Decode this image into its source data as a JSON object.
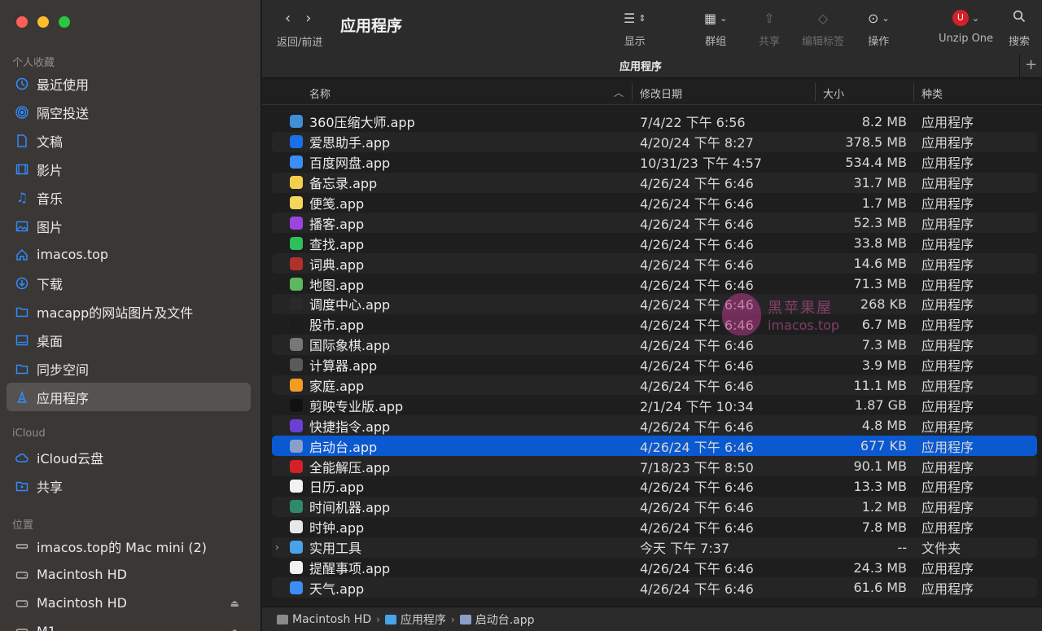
{
  "sidebar": {
    "sections": [
      {
        "title": "个人收藏",
        "items": [
          {
            "label": "最近使用",
            "icon": "clock-icon"
          },
          {
            "label": "隔空投送",
            "icon": "airdrop-icon"
          },
          {
            "label": "文稿",
            "icon": "document-icon"
          },
          {
            "label": "影片",
            "icon": "film-icon"
          },
          {
            "label": "音乐",
            "icon": "music-icon"
          },
          {
            "label": "图片",
            "icon": "photo-icon"
          },
          {
            "label": "imacos.top",
            "icon": "home-icon"
          },
          {
            "label": "下载",
            "icon": "download-icon"
          },
          {
            "label": "macapp的网站图片及文件",
            "icon": "folder-icon"
          },
          {
            "label": "桌面",
            "icon": "desktop-icon"
          },
          {
            "label": "同步空间",
            "icon": "folder-icon"
          },
          {
            "label": "应用程序",
            "icon": "applications-icon",
            "active": true
          }
        ]
      },
      {
        "title": "iCloud",
        "items": [
          {
            "label": "iCloud云盘",
            "icon": "cloud-icon"
          },
          {
            "label": "共享",
            "icon": "shared-folder-icon"
          }
        ]
      },
      {
        "title": "位置",
        "items": [
          {
            "label": "imacos.top的 Mac mini (2)",
            "icon": "computer-icon"
          },
          {
            "label": "Macintosh HD",
            "icon": "disk-icon"
          },
          {
            "label": "Macintosh HD",
            "icon": "disk-icon",
            "eject": true
          },
          {
            "label": "M1",
            "icon": "disk-icon",
            "eject": true
          }
        ]
      }
    ]
  },
  "toolbar": {
    "nav_label": "返回/前进",
    "title": "应用程序",
    "buttons": [
      {
        "label": "显示",
        "icon": "list-view-icon"
      },
      {
        "label": "群组",
        "icon": "group-icon"
      },
      {
        "label": "共享",
        "icon": "share-icon",
        "disabled": true
      },
      {
        "label": "编辑标签",
        "icon": "tag-icon",
        "disabled": true
      },
      {
        "label": "操作",
        "icon": "action-icon"
      },
      {
        "label": "Unzip One",
        "icon": "unzip-one-icon"
      },
      {
        "label": "搜索",
        "icon": "search-icon"
      }
    ]
  },
  "tabbar": {
    "title": "应用程序",
    "add": "+"
  },
  "columns": {
    "name": "名称",
    "date": "修改日期",
    "size": "大小",
    "kind": "种类"
  },
  "files": [
    {
      "name": "360压缩大师.app",
      "date": "7/4/22 下午 6:56",
      "size": "8.2 MB",
      "kind": "应用程序",
      "color": "#3e8fd6"
    },
    {
      "name": "爱思助手.app",
      "date": "4/20/24 下午 8:27",
      "size": "378.5 MB",
      "kind": "应用程序",
      "color": "#1b6fe8"
    },
    {
      "name": "百度网盘.app",
      "date": "10/31/23 下午 4:57",
      "size": "534.4 MB",
      "kind": "应用程序",
      "color": "#3a8ef5"
    },
    {
      "name": "备忘录.app",
      "date": "4/26/24 下午 6:46",
      "size": "31.7 MB",
      "kind": "应用程序",
      "color": "#f3d04a"
    },
    {
      "name": "便笺.app",
      "date": "4/26/24 下午 6:46",
      "size": "1.7 MB",
      "kind": "应用程序",
      "color": "#f5d65a"
    },
    {
      "name": "播客.app",
      "date": "4/26/24 下午 6:46",
      "size": "52.3 MB",
      "kind": "应用程序",
      "color": "#9b45dd"
    },
    {
      "name": "查找.app",
      "date": "4/26/24 下午 6:46",
      "size": "33.8 MB",
      "kind": "应用程序",
      "color": "#2fbf5b"
    },
    {
      "name": "词典.app",
      "date": "4/26/24 下午 6:46",
      "size": "14.6 MB",
      "kind": "应用程序",
      "color": "#b2302c"
    },
    {
      "name": "地图.app",
      "date": "4/26/24 下午 6:46",
      "size": "71.3 MB",
      "kind": "应用程序",
      "color": "#5cb85c"
    },
    {
      "name": "调度中心.app",
      "date": "4/26/24 下午 6:46",
      "size": "268 KB",
      "kind": "应用程序",
      "color": "#2a2a2a"
    },
    {
      "name": "股市.app",
      "date": "4/26/24 下午 6:46",
      "size": "6.7 MB",
      "kind": "应用程序",
      "color": "#1c1c1c"
    },
    {
      "name": "国际象棋.app",
      "date": "4/26/24 下午 6:46",
      "size": "7.3 MB",
      "kind": "应用程序",
      "color": "#777777"
    },
    {
      "name": "计算器.app",
      "date": "4/26/24 下午 6:46",
      "size": "3.9 MB",
      "kind": "应用程序",
      "color": "#5a5a5a"
    },
    {
      "name": "家庭.app",
      "date": "4/26/24 下午 6:46",
      "size": "11.1 MB",
      "kind": "应用程序",
      "color": "#f39c24"
    },
    {
      "name": "剪映专业版.app",
      "date": "2/1/24 下午 10:34",
      "size": "1.87 GB",
      "kind": "应用程序",
      "color": "#111111"
    },
    {
      "name": "快捷指令.app",
      "date": "4/26/24 下午 6:46",
      "size": "4.8 MB",
      "kind": "应用程序",
      "color": "#6a3fd8"
    },
    {
      "name": "启动台.app",
      "date": "4/26/24 下午 6:46",
      "size": "677 KB",
      "kind": "应用程序",
      "color": "#8aa0c8",
      "selected": true
    },
    {
      "name": "全能解压.app",
      "date": "7/18/23 下午 8:50",
      "size": "90.1 MB",
      "kind": "应用程序",
      "color": "#d5202a"
    },
    {
      "name": "日历.app",
      "date": "4/26/24 下午 6:46",
      "size": "13.3 MB",
      "kind": "应用程序",
      "color": "#f2f2f2"
    },
    {
      "name": "时间机器.app",
      "date": "4/26/24 下午 6:46",
      "size": "1.2 MB",
      "kind": "应用程序",
      "color": "#2d8a6b"
    },
    {
      "name": "时钟.app",
      "date": "4/26/24 下午 6:46",
      "size": "7.8 MB",
      "kind": "应用程序",
      "color": "#e8e8e8"
    },
    {
      "name": "实用工具",
      "date": "今天 下午 7:37",
      "size": "--",
      "kind": "文件夹",
      "color": "#4aa3e8",
      "folder": true
    },
    {
      "name": "提醒事项.app",
      "date": "4/26/24 下午 6:46",
      "size": "24.3 MB",
      "kind": "应用程序",
      "color": "#f2f2f2"
    },
    {
      "name": "天气.app",
      "date": "4/26/24 下午 6:46",
      "size": "61.6 MB",
      "kind": "应用程序",
      "color": "#3a8ef5"
    }
  ],
  "watermark": {
    "line1": "黑苹果屋",
    "line2": "imacos.top"
  },
  "pathbar": [
    "Macintosh HD",
    "应用程序",
    "启动台.app"
  ]
}
